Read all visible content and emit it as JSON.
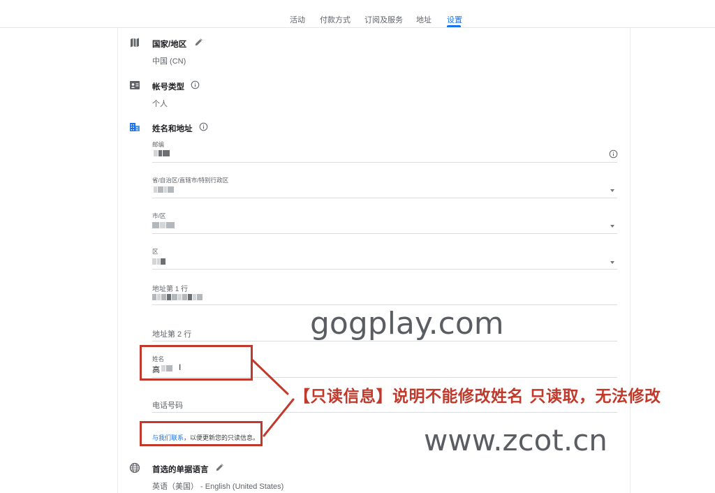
{
  "nav": {
    "tabs": [
      "活动",
      "付款方式",
      "订阅及服务",
      "地址",
      "设置"
    ],
    "active_tab": "设置"
  },
  "sections": {
    "country": {
      "title": "国家/地区",
      "value": "中国 (CN)"
    },
    "account_type": {
      "title": "帐号类型",
      "value": "个人"
    },
    "name_address": {
      "title": "姓名和地址"
    },
    "language": {
      "title": "首选的单据语言",
      "value": "英语（美国） - English (United States)"
    }
  },
  "fields": {
    "postal": {
      "label": "邮编"
    },
    "province": {
      "label": "省/自治区/直辖市/特别行政区"
    },
    "city": {
      "label": "市/区"
    },
    "district": {
      "label": "区"
    },
    "address1": {
      "label": "地址第 1 行"
    },
    "address2": {
      "placeholder": "地址第 2 行"
    },
    "name": {
      "label": "姓名",
      "value_prefix": "高"
    },
    "phone": {
      "placeholder": "电话号码"
    }
  },
  "contact": {
    "link": "与我们联系",
    "rest": "，以便更新您的只读信息。"
  },
  "annotation": {
    "text": "【只读信息】说明不能修改姓名 只读取，无法修改",
    "color": "#c0392b"
  },
  "watermarks": {
    "one": "gogplay.com",
    "two": "www.zcot.cn"
  },
  "colors": {
    "accent": "#1a73e8",
    "annotation_red": "#c0392b"
  }
}
